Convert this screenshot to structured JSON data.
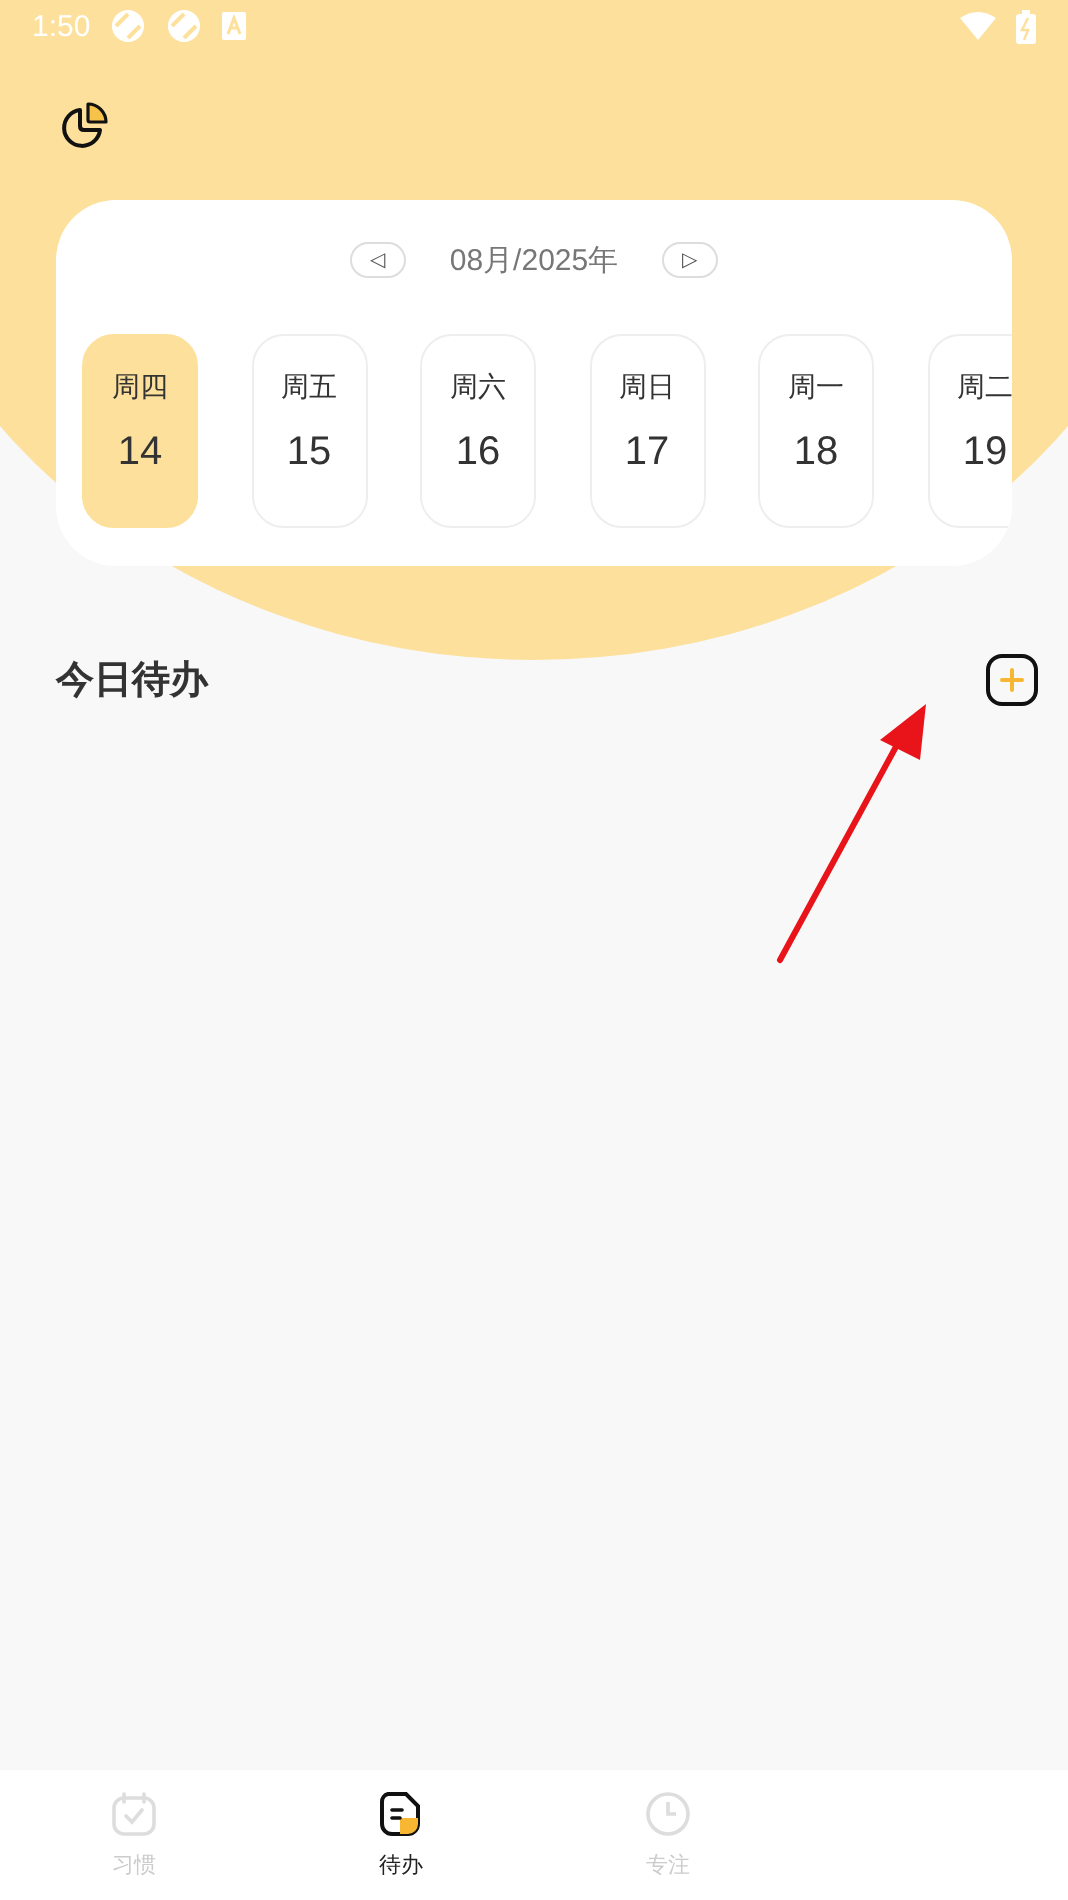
{
  "status_bar": {
    "time": "1:50"
  },
  "calendar": {
    "month_label": "08月/2025年",
    "prev": "◁",
    "next": "▷",
    "days": [
      {
        "weekday": "周四",
        "date": "14",
        "selected": true
      },
      {
        "weekday": "周五",
        "date": "15",
        "selected": false
      },
      {
        "weekday": "周六",
        "date": "16",
        "selected": false
      },
      {
        "weekday": "周日",
        "date": "17",
        "selected": false
      },
      {
        "weekday": "周一",
        "date": "18",
        "selected": false
      },
      {
        "weekday": "周二",
        "date": "19",
        "selected": false
      }
    ]
  },
  "section": {
    "title": "今日待办"
  },
  "tabs": [
    {
      "label": "习惯",
      "kind": "habit",
      "selected": false
    },
    {
      "label": "待办",
      "kind": "todo",
      "selected": true
    },
    {
      "label": "专注",
      "kind": "focus",
      "selected": false
    }
  ]
}
